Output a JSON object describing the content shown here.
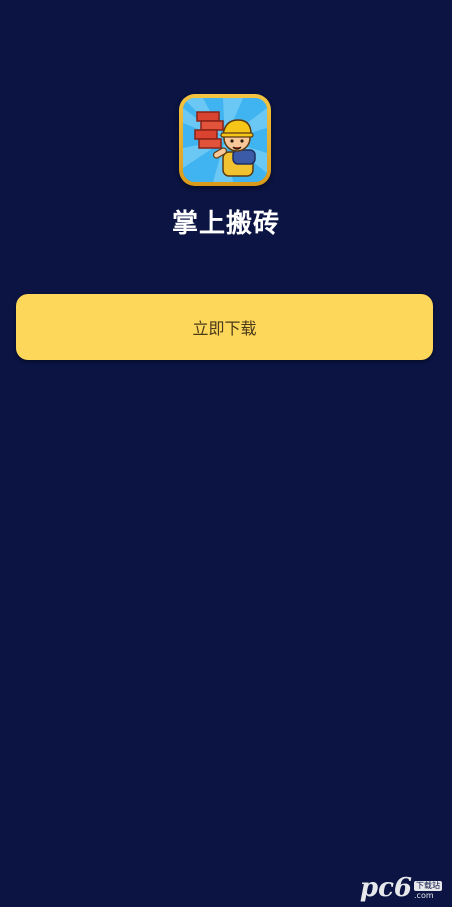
{
  "app": {
    "title": "掌上搬砖",
    "icon": "brick-worker-game-icon"
  },
  "actions": {
    "download_label": "立即下载"
  },
  "watermark": {
    "logo": "pc6",
    "tag": "下载站",
    "domain": ".com"
  },
  "colors": {
    "background": "#0b1442",
    "button": "#fdd75a",
    "button_text": "#4a3a1a",
    "title": "#ffffff"
  }
}
